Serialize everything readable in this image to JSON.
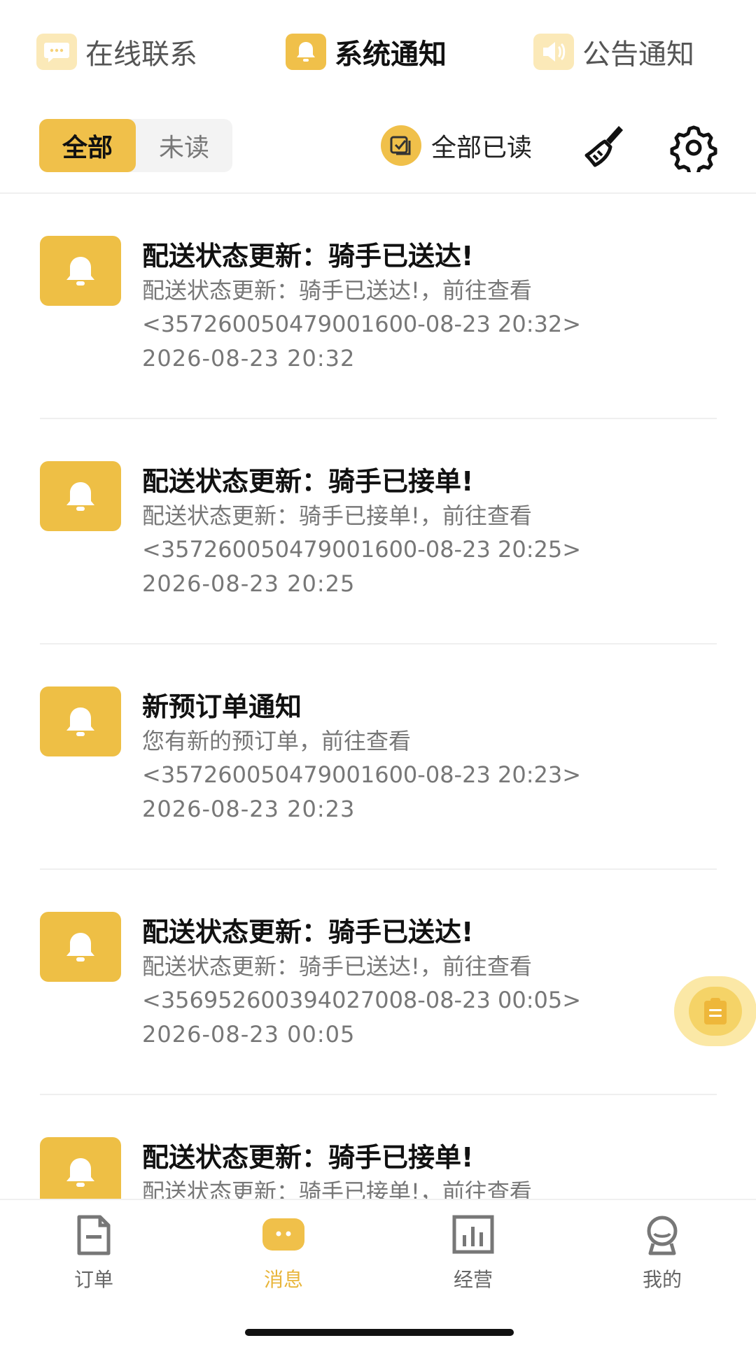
{
  "top_tabs": [
    {
      "label": "在线联系",
      "icon": "chat-bubble-icon",
      "active": false
    },
    {
      "label": "系统通知",
      "icon": "bell-icon",
      "active": true
    },
    {
      "label": "公告通知",
      "icon": "speaker-icon",
      "active": false
    }
  ],
  "filter": {
    "all_label": "全部",
    "unread_label": "未读",
    "selected": "全部",
    "mark_all_read_label": "全部已读"
  },
  "notifications": [
    {
      "title": "配送状态更新：骑手已送达!",
      "desc_line1": "配送状态更新：骑手已送达!，前往查看",
      "desc_line2": "<35726005047900160​0-08-23 20:32>",
      "time": "2026-08-23 20:32"
    },
    {
      "title": "配送状态更新：骑手已接单!",
      "desc_line1": "配送状态更新：骑手已接单!，前往查看",
      "desc_line2": "<357260050479001600-08-23 20:25>",
      "time": "2026-08-23 20:25"
    },
    {
      "title": "新预订单通知",
      "desc_line1": "您有新的预订单，前往查看",
      "desc_line2": "<357260050479001600-08-23 20:23>",
      "time": "2026-08-23 20:23"
    },
    {
      "title": "配送状态更新：骑手已送达!",
      "desc_line1": "配送状态更新：骑手已送达!，前往查看",
      "desc_line2": "<356952600394027008-08-23 00:05>",
      "time": "2026-08-23 00:05"
    },
    {
      "title": "配送状态更新：骑手已接单!",
      "desc_line1": "配送状态更新：骑手已接单!，前往查看",
      "desc_line2": "",
      "time": ""
    }
  ],
  "bottom_nav": [
    {
      "label": "订单",
      "icon": "order-doc-icon",
      "active": false
    },
    {
      "label": "消息",
      "icon": "message-icon",
      "active": true
    },
    {
      "label": "经营",
      "icon": "chart-icon",
      "active": false
    },
    {
      "label": "我的",
      "icon": "profile-icon",
      "active": false
    }
  ],
  "colors": {
    "accent": "#f0c04a",
    "accent_light": "#fbe9b8",
    "active_nav": "#e8b53a"
  }
}
